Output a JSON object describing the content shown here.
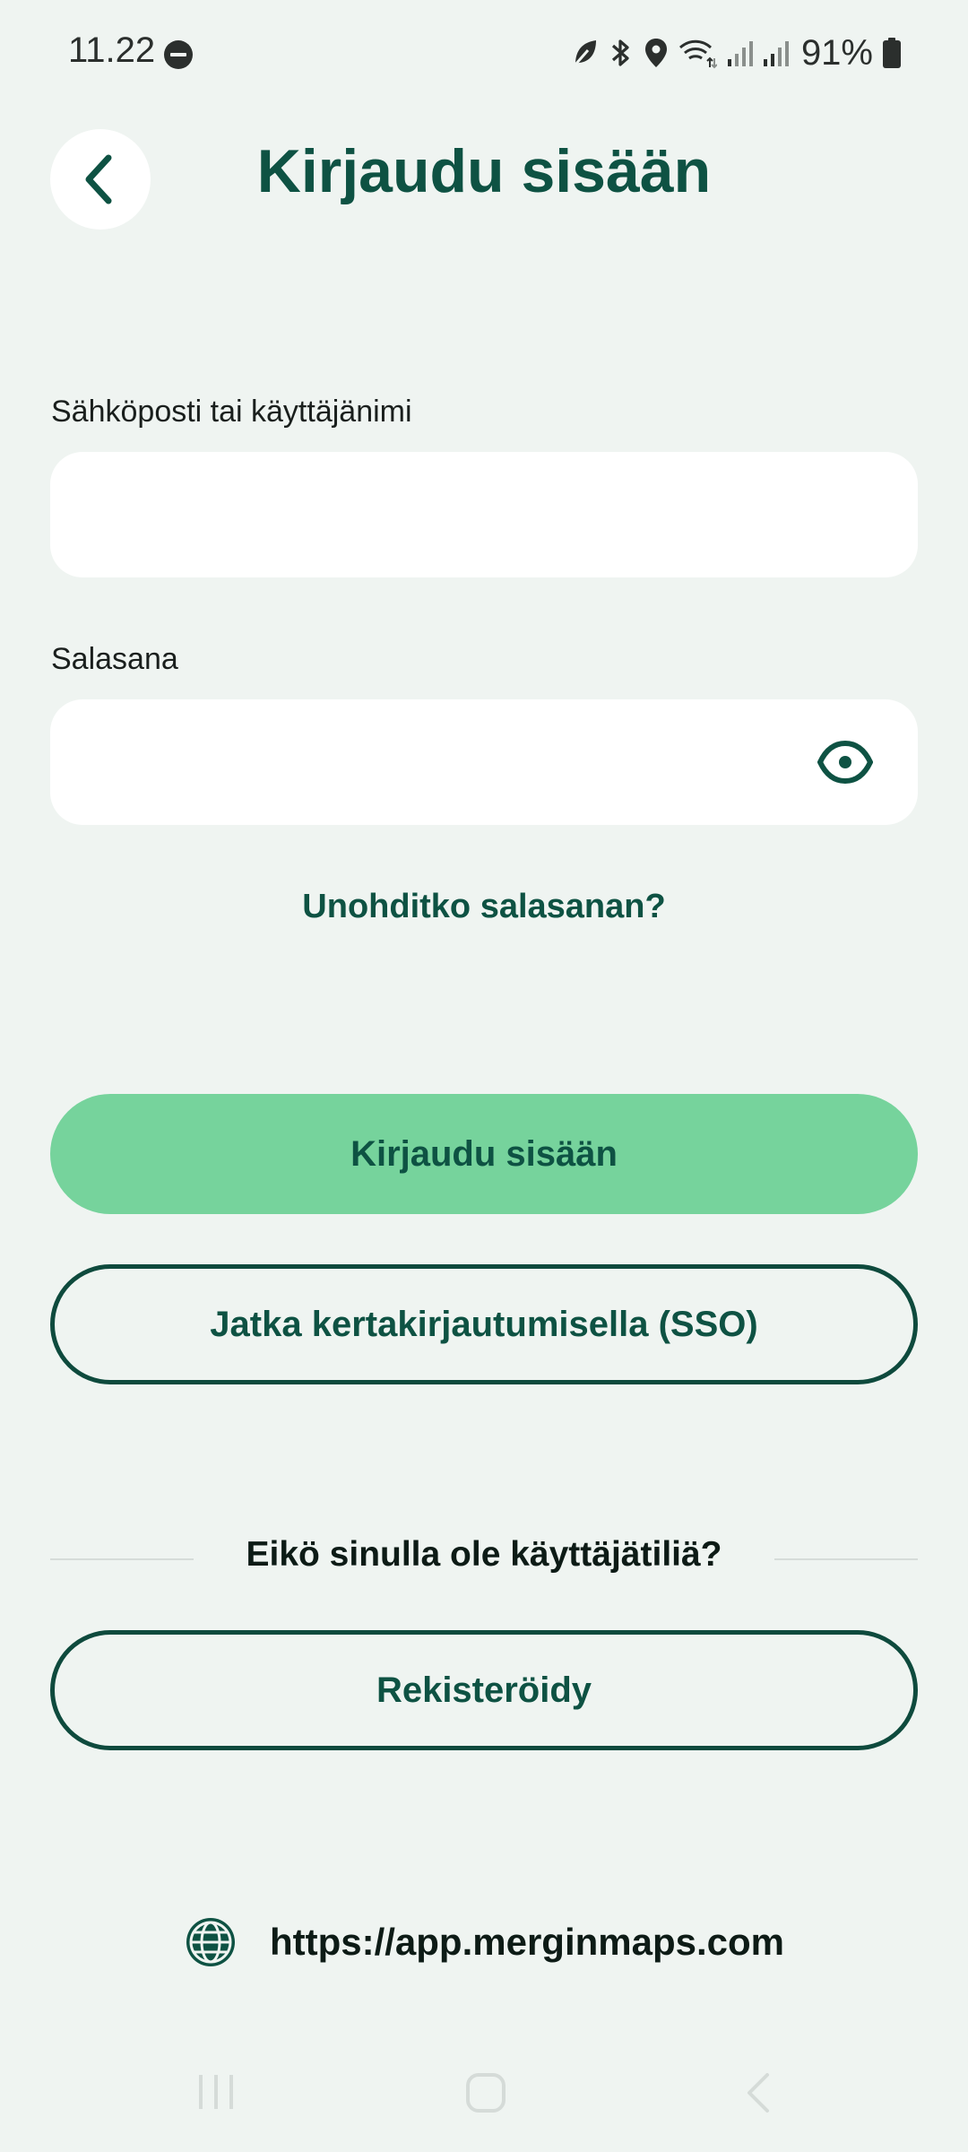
{
  "status_bar": {
    "time": "11.22",
    "battery": "91%",
    "icons": [
      "do-not-disturb-icon",
      "leaf-icon",
      "bluetooth-icon",
      "location-icon",
      "wifi-icon",
      "signal-icon",
      "signal-icon",
      "battery-icon"
    ]
  },
  "header": {
    "back_icon": "chevron-left-icon",
    "title": "Kirjaudu sisään"
  },
  "form": {
    "username_label": "Sähköposti tai käyttäjänimi",
    "username_value": "",
    "password_label": "Salasana",
    "password_value": "",
    "password_toggle_icon": "eye-icon",
    "forgot_password": "Unohditko salasanan?"
  },
  "actions": {
    "login_label": "Kirjaudu sisään",
    "sso_label": "Jatka kertakirjautumisella (SSO)",
    "no_account_text": "Eikö sinulla ole käyttäjätiliä?",
    "register_label": "Rekisteröidy"
  },
  "server": {
    "icon": "globe-icon",
    "url": "https://app.merginmaps.com"
  },
  "colors": {
    "background": "#eff4f1",
    "brand_dark": "#0e5243",
    "brand_green": "#76d39c",
    "field_bg": "#ffffff"
  }
}
